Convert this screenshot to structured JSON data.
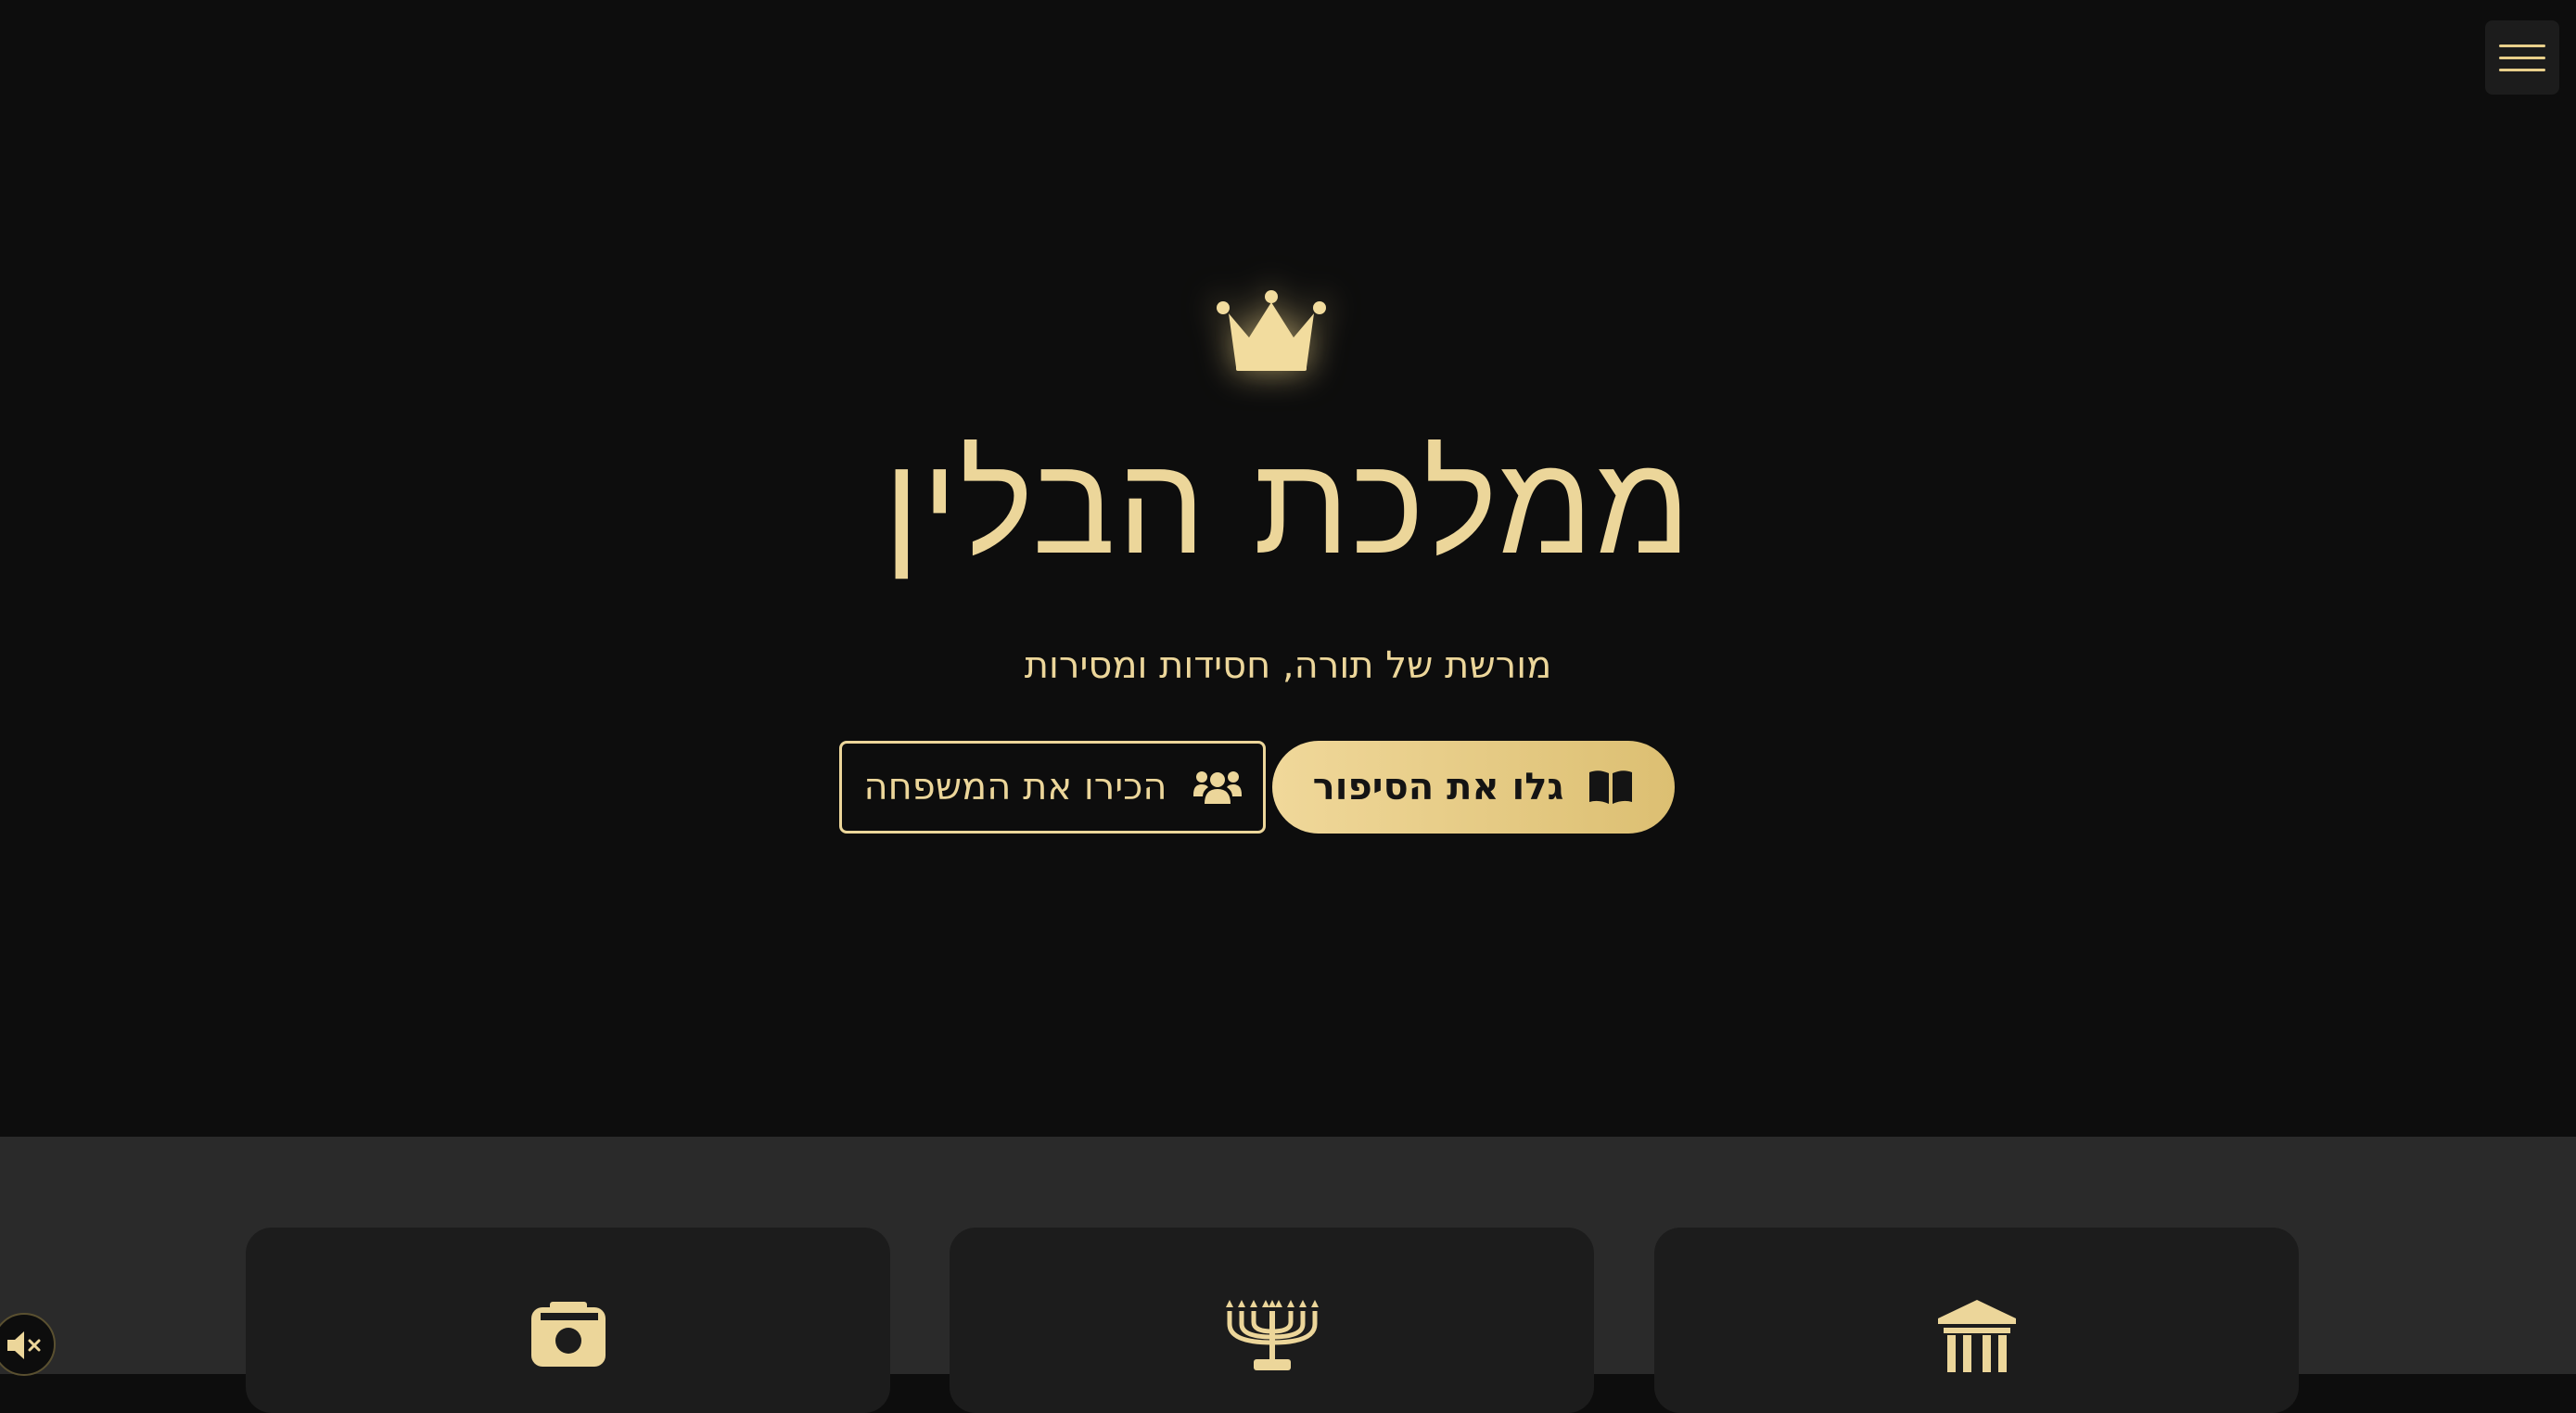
{
  "header": {
    "menu_icon": "hamburger-menu-icon"
  },
  "hero": {
    "icon": "crown-icon",
    "title": "ממלכת הבלין",
    "subtitle": "מורשת של תורה, חסידות ומסירות",
    "primary_button": {
      "label": "גלו את הסיפור",
      "icon": "open-book-icon"
    },
    "secondary_button": {
      "label": "הכירו את המשפחה",
      "icon": "users-icon"
    }
  },
  "features": {
    "cards": [
      {
        "icon": "camera-icon"
      },
      {
        "icon": "menorah-icon"
      },
      {
        "icon": "landmark-icon"
      }
    ]
  },
  "audio": {
    "icon": "volume-mute-icon"
  },
  "colors": {
    "background": "#0d0d0d",
    "accent_gold": "#ecd69a",
    "section_background": "#2a2a2a",
    "card_background": "#1c1c1c"
  }
}
